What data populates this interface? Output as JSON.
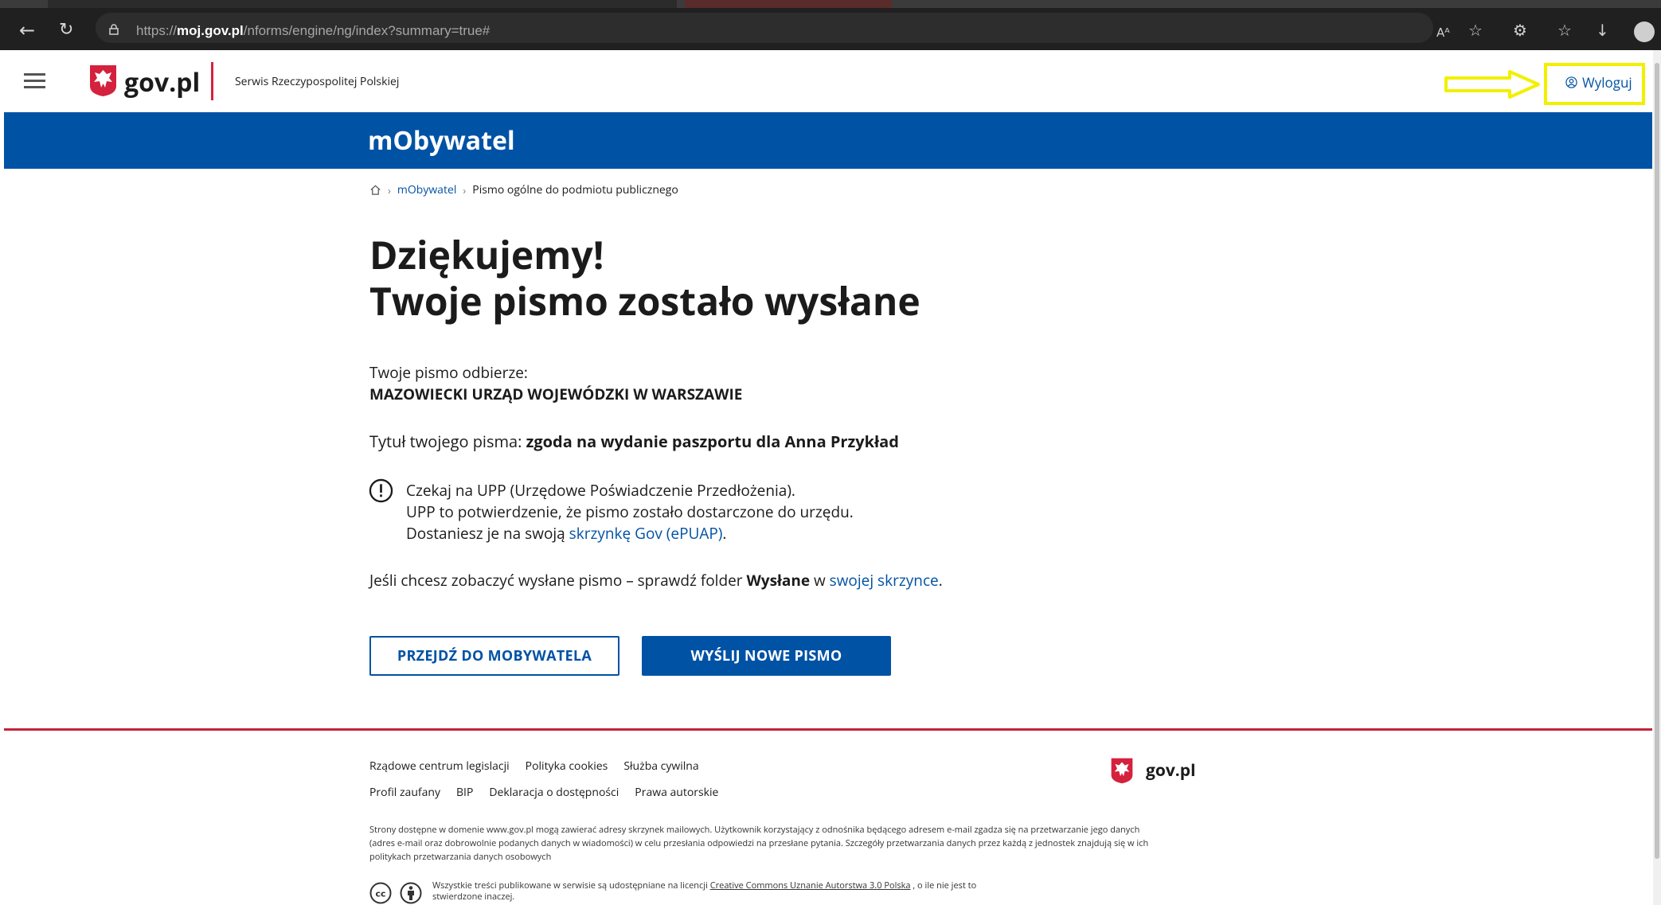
{
  "browser": {
    "url_prefix": "https://",
    "url_domain": "moj.gov.pl",
    "url_path": "/nforms/engine/ng/index?summary=true#",
    "back_icon": "back-arrow-icon",
    "reload_icon": "reload-icon",
    "read_aloud_label": "Aᴬ"
  },
  "header": {
    "logo_text": "gov.pl",
    "subtitle": "Serwis Rzeczypospolitej Polskiej",
    "logout_label": "Wyloguj",
    "highlight_color": "#f2f000"
  },
  "banner": {
    "title": "mObywatel",
    "color": "#0052a5"
  },
  "breadcrumb": {
    "items": [
      "mObywatel",
      "Pismo ogólne do podmiotu publicznego"
    ]
  },
  "main": {
    "heading_line1": "Dziękujemy!",
    "heading_line2": "Twoje pismo zostało wysłane",
    "recipient_label": "Twoje pismo odbierze:",
    "recipient_name": "MAZOWIECKI URZĄD WOJEWÓDZKI W WARSZAWIE",
    "title_label": "Tytuł twojego pisma: ",
    "title_value": "zgoda na wydanie paszportu dla Anna Przykład",
    "info_line1": "Czekaj na UPP (Urzędowe Poświadczenie Przedłożenia).",
    "info_line2": "UPP to potwierdzenie, że pismo zostało dostarczone do urzędu.",
    "info_line3_prefix": "Dostaniesz je na swoją ",
    "info_line3_link": "skrzynkę Gov (ePUAP)",
    "info_line3_suffix": ".",
    "sent_prefix": "Jeśli chcesz zobaczyć wysłane pismo – sprawdź folder ",
    "sent_folder": "Wysłane",
    "sent_middle": " w ",
    "sent_link": "swojej skrzynce",
    "sent_suffix": ".",
    "btn_go": "PRZEJDŹ DO MOBYWATELA",
    "btn_new": "WYŚLIJ NOWE PISMO"
  },
  "footer": {
    "links_row1": [
      "Rządowe centrum legislacji",
      "Polityka cookies",
      "Służba cywilna"
    ],
    "links_row2": [
      "Profil zaufany",
      "BIP",
      "Deklaracja o dostępności",
      "Prawa autorskie"
    ],
    "logo_text": "gov.pl",
    "disclaimer": "Strony dostępne w domenie www.gov.pl mogą zawierać adresy skrzynek mailowych. Użytkownik korzystający z odnośnika będącego adresem e-mail zgadza się na przetwarzanie jego danych (adres e-mail oraz dobrowolnie podanych danych w wiadomości) w celu przesłania odpowiedzi na przesłane pytania. Szczegóły przetwarzania danych przez każdą z jednostek znajdują się w ich politykach przetwarzania danych osobowych",
    "license_prefix": "Wszystkie treści publikowane w serwisie są udostępniane na licencji ",
    "license_link": "Creative Commons Uznanie Autorstwa 3.0 Polska",
    "license_suffix": " , o ile nie jest to stwierdzone inaczej."
  }
}
